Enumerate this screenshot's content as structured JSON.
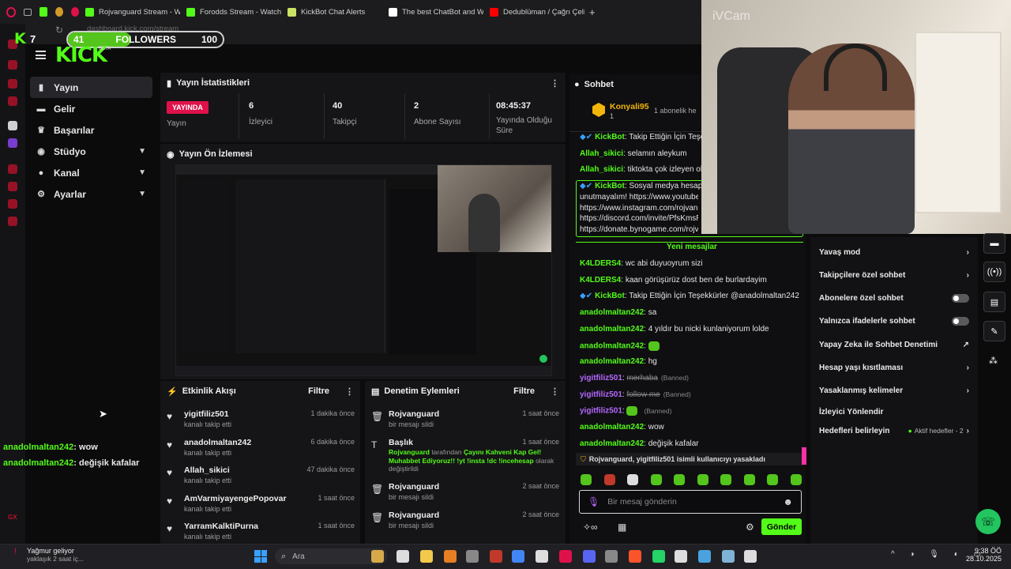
{
  "browser": {
    "tabs": [
      {
        "label": "Rojvanguard Stream - Wa",
        "color": "#53fc18"
      },
      {
        "label": "Forodds Stream - Watch",
        "color": "#53fc18"
      },
      {
        "label": "KickBot Chat Alerts",
        "color": "#c9e265"
      },
      {
        "label": "The best ChatBot and W",
        "color": "#ffffff"
      },
      {
        "label": "Dedublüman / Çağrı Çelik",
        "color": "#ff0000"
      }
    ],
    "new_tab": "+",
    "url": "dashboard.kick.com/stream"
  },
  "overlay": {
    "followers_current": "41",
    "followers_label": "FOLLOWERS",
    "followers_goal": "100",
    "followers_progress": 0.41,
    "webcam_watermark": "iVCam",
    "k_count": "7"
  },
  "logo": {
    "text": "KICK",
    "beta": "BETA"
  },
  "nav": [
    {
      "label": "Yayın",
      "icon": "broadcast-icon",
      "glyph": "▮",
      "chevron": false,
      "active": true
    },
    {
      "label": "Gelir",
      "icon": "wallet-icon",
      "glyph": "▬",
      "chevron": false,
      "active": false
    },
    {
      "label": "Başarılar",
      "icon": "trophy-icon",
      "glyph": "♛",
      "chevron": false,
      "active": false
    },
    {
      "label": "Stüdyo",
      "icon": "studio-icon",
      "glyph": "◉",
      "chevron": true,
      "active": false
    },
    {
      "label": "Kanal",
      "icon": "user-icon",
      "glyph": "●",
      "chevron": true,
      "active": false
    },
    {
      "label": "Ayarlar",
      "icon": "gear-icon",
      "glyph": "⚙",
      "chevron": true,
      "active": false
    }
  ],
  "left_chat_overlay": [
    {
      "user": "anadolmaltan242",
      "text": "wow"
    },
    {
      "user": "anadolmaltan242",
      "text": "değişik kafalar"
    }
  ],
  "stats": {
    "title": "Yayın İstatistikleri",
    "live_badge": "YAYINDA",
    "items": [
      {
        "value": "",
        "label": "Yayın"
      },
      {
        "value": "6",
        "label": "İzleyici"
      },
      {
        "value": "40",
        "label": "Takipçi"
      },
      {
        "value": "2",
        "label": "Abone Sayısı"
      },
      {
        "value": "08:45:37",
        "label": "Yayında Olduğu Süre"
      }
    ]
  },
  "preview": {
    "title": "Yayın Ön İzlemesi"
  },
  "activity": {
    "title": "Etkinlik Akışı",
    "filter": "Filtre",
    "rows": [
      {
        "name": "yigitfiliz501",
        "sub": "kanalı takip etti",
        "time": "1 dakika önce"
      },
      {
        "name": "anadolmaltan242",
        "sub": "kanalı takip etti",
        "time": "6 dakika önce"
      },
      {
        "name": "Allah_sikici",
        "sub": "kanalı takip etti",
        "time": "47 dakika önce"
      },
      {
        "name": "AmVarmiyayengePopovar",
        "sub": "kanalı takip etti",
        "time": "1 saat önce"
      },
      {
        "name": "YarramKalktiPurna",
        "sub": "kanalı takip etti",
        "time": "1 saat önce"
      }
    ]
  },
  "moderation": {
    "title": "Denetim Eylemleri",
    "filter": "Filtre",
    "rows": [
      {
        "name": "Rojvanguard",
        "sub": "bir mesajı sildi",
        "time": "1 saat önce"
      },
      {
        "name": "Başlık",
        "time": "1 saat önce",
        "actor": "Rojvanguard",
        "pre": " tarafından ",
        "quote": "Çayını Kahveni Kap Gel! Muhabbet Ediyoruz!! !yt !insta !dc !incehesap",
        "post": " olarak değiştirildi"
      },
      {
        "name": "Rojvanguard",
        "sub": "bir mesajı sildi",
        "time": "2 saat önce"
      },
      {
        "name": "Rojvanguard",
        "sub": "bir mesajı sildi",
        "time": "2 saat önce"
      }
    ]
  },
  "chat": {
    "title": "Sohbet",
    "pinned_user": "Konyali95",
    "pinned_count": "1",
    "pinned_sub": "1 abonelik he",
    "messages_top": [
      {
        "user": "KickBot",
        "text": "Takip Ettiğin İçin Teşe",
        "bot": true
      },
      {
        "user": "Allah_sikici",
        "text": "selamın aleykum"
      },
      {
        "user": "Allah_sikici",
        "text": "tiktokta çok izleyen oluo"
      }
    ],
    "linkbox": {
      "user": "KickBot",
      "intro": "Sosyal medya hesapl",
      "lines": [
        "unutmayalım! https://www.youtube.co",
        "https://www.instagram.com/rojvangua",
        "https://discord.com/invite/PfsKmsRM",
        "https://donate.bynogame.com/rojvang"
      ]
    },
    "new_messages": "Yeni mesajlar",
    "messages": [
      {
        "user": "K4LDERS4",
        "text": "wc abi duyuoyrum sizi"
      },
      {
        "user": "K4LDERS4",
        "text": "kaan görüşürüz dost ben de burlardayim"
      },
      {
        "user": "KickBot",
        "text": "Takip Ettiğin İçin Teşekkürler @anadolmaltan242",
        "bot": true
      },
      {
        "user": "anadolmaltan242",
        "text": "sa"
      },
      {
        "user": "anadolmaltan242",
        "text": "4 yıldır bu nicki kunlaniyorum lolde"
      },
      {
        "user": "anadolmaltan242",
        "text": "",
        "emote": true
      },
      {
        "user": "anadolmaltan242",
        "text": "hg"
      },
      {
        "user": "yigitfiliz501",
        "text": "merhaba",
        "banned": true,
        "tag": "(Banned)"
      },
      {
        "user": "yigitfiliz501",
        "text": "follow me",
        "banned": true,
        "tag": "(Banned)"
      },
      {
        "user": "yigitfiliz501",
        "text": "",
        "banned": true,
        "tag": "(Banned)",
        "emote": true
      },
      {
        "user": "anadolmaltan242",
        "text": "wow"
      },
      {
        "user": "anadolmaltan242",
        "text": "değişik kafalar"
      }
    ],
    "ban_notice": "Rojvanguard, yigitfiliz501 isimli kullanıcıyı yasakladı",
    "input_placeholder": "Bir mesaj gönderin",
    "send": "Gönder"
  },
  "settings_menu": {
    "rows": [
      {
        "label": "Yavaş mod",
        "kind": "arrow"
      },
      {
        "label": "Takipçilere özel sohbet",
        "kind": "arrow"
      },
      {
        "label": "Abonelere özel sohbet",
        "kind": "toggle"
      },
      {
        "label": "Yalnızca ifadelerle sohbet",
        "kind": "toggle"
      },
      {
        "label": "Yapay Zeka ile Sohbet Denetimi",
        "kind": "external"
      },
      {
        "label": "Hesap yaşı kısıtlaması",
        "kind": "arrow"
      },
      {
        "label": "Yasaklanmış kelimeler",
        "kind": "arrow"
      },
      {
        "label": "İzleyici Yönlendir",
        "kind": "none"
      },
      {
        "label": "Hedefleri belirleyin",
        "kind": "goal",
        "extra": "Aktif hedefler - 2"
      }
    ]
  },
  "taskbar": {
    "weather_title": "Yağmur geliyor",
    "weather_sub": "yaklaşık 2 saat iç...",
    "search": "Ara",
    "time": "9:38 ÖÖ",
    "date": "28.10.2025"
  },
  "colors": {
    "accent": "#53fc18",
    "live": "#e0114a",
    "ban": "#b568ff"
  }
}
